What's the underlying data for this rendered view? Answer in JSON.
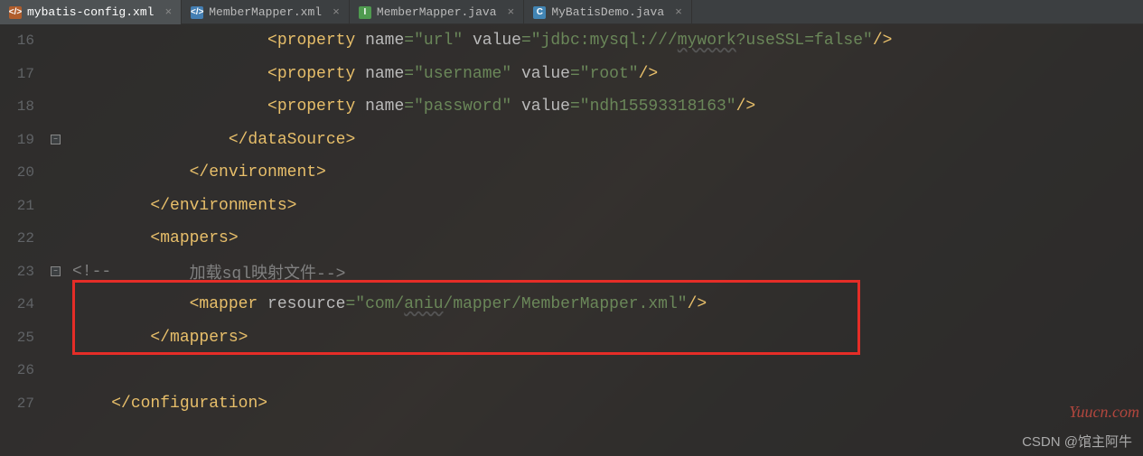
{
  "tabs": [
    {
      "label": "mybatis-config.xml",
      "active": true
    },
    {
      "label": "MemberMapper.xml",
      "active": false
    },
    {
      "label": "MemberMapper.java",
      "active": false
    },
    {
      "label": "MyBatisDemo.java",
      "active": false
    }
  ],
  "gutter": {
    "start": 16,
    "count": 12
  },
  "code": {
    "prop1_tag_open": "<property ",
    "prop_name_attr": "name",
    "prop_val_attr": "value",
    "eq": "=",
    "prop1_name": "\"url\"",
    "prop1_value": "\"jdbc:mysql:///",
    "prop1_value_mywork": "mywork",
    "prop1_value_tail": "?useSSL=false\"",
    "self_close": "/>",
    "prop2_name": "\"username\"",
    "prop2_value": "\"root\"",
    "prop3_name": "\"password\"",
    "prop3_value": "\"ndh15593318163\"",
    "ds_close": "</dataSource>",
    "env_close": "</environment>",
    "envs_close": "</environments>",
    "mappers_open": "<mappers>",
    "comment_open": "<!--",
    "comment_body": "        加载sql映射文件-->",
    "mapper_open": "<mapper ",
    "mapper_attr": "resource",
    "mapper_value": "\"com/",
    "mapper_value_aniu": "aniu",
    "mapper_value_tail": "/mapper/MemberMapper.xml\"",
    "mappers_close": "</mappers>",
    "config_close": "</configuration>"
  },
  "watermark_csdn": "CSDN @馆主阿牛",
  "watermark_yuucn": "Yuucn.com"
}
